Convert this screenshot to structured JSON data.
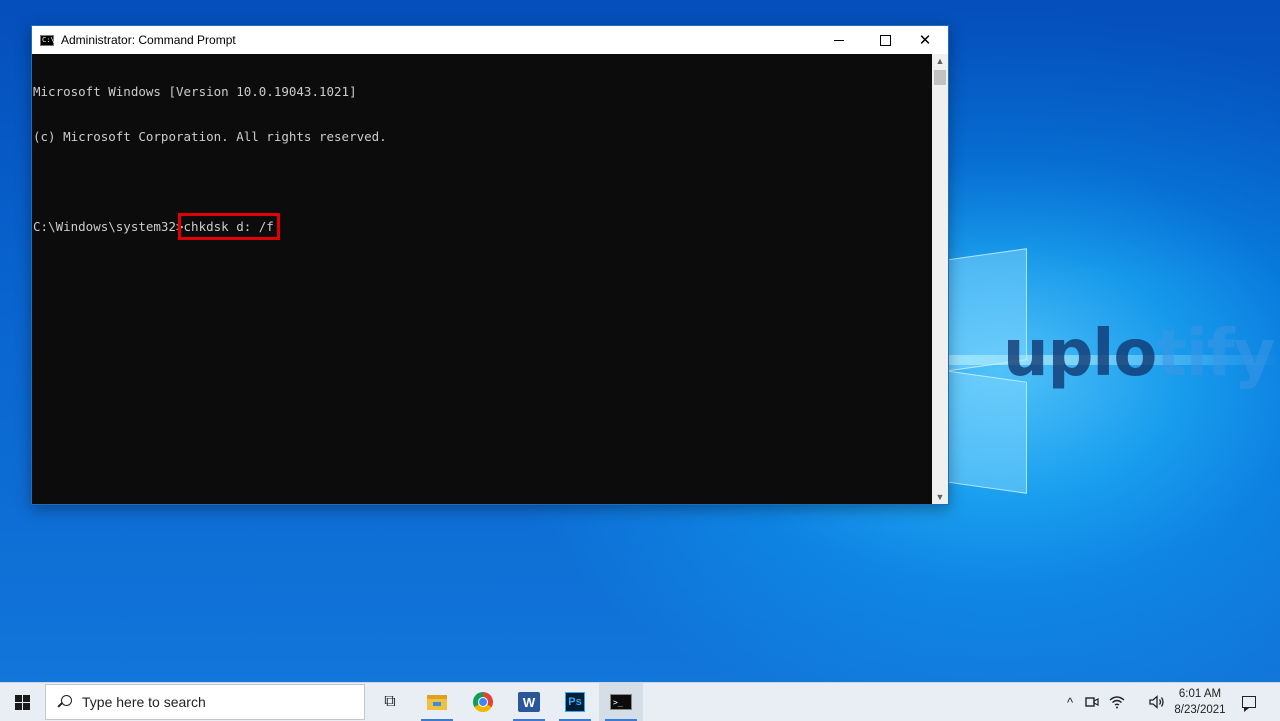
{
  "desktop": {
    "watermark_main": "uplo",
    "watermark_rest": "tify"
  },
  "window": {
    "title": "Administrator: Command Prompt",
    "icon": "cmd-icon",
    "icon_glyph": "C:\\",
    "controls": {
      "minimize": "minimize-icon",
      "maximize": "maximize-icon",
      "close": "✕"
    }
  },
  "console": {
    "line1": "Microsoft Windows [Version 10.0.19043.1021]",
    "line2": "(c) Microsoft Corporation. All rights reserved.",
    "prompt": "C:\\Windows\\system32>",
    "command": "chkdsk d: /f"
  },
  "scrollbar": {
    "up": "▲",
    "down": "▼"
  },
  "taskbar": {
    "search_placeholder": "Type here to search",
    "taskview_glyph": "⧉",
    "apps": {
      "word_glyph": "W",
      "ps_glyph": "Ps",
      "cmd_glyph": ">_"
    },
    "tray": {
      "chevron": "^",
      "wifi": "◠",
      "volume": "🔈"
    },
    "clock": {
      "time": "6:01 AM",
      "date": "8/23/2021"
    }
  },
  "colors": {
    "highlight": "#e00000",
    "console_bg": "#0c0c0c",
    "console_text": "#cccccc"
  }
}
